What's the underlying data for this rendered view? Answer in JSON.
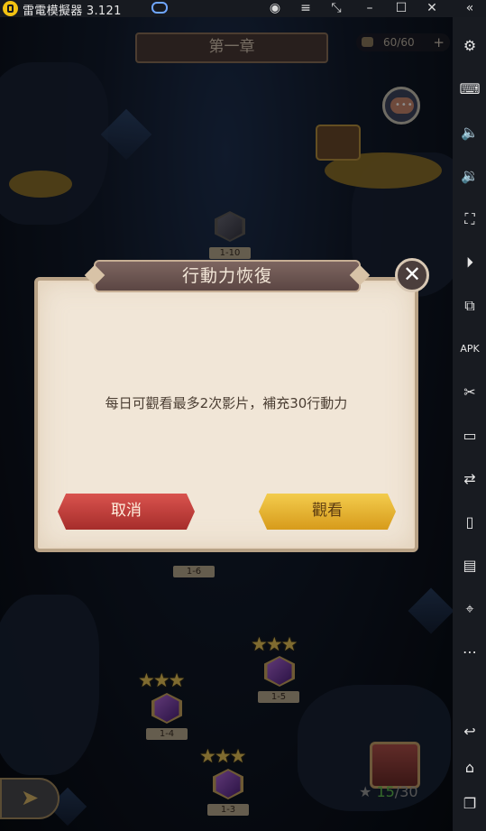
{
  "window": {
    "title": "雷電模擬器 3.121",
    "controls": [
      "account-icon",
      "menu-icon",
      "resize-icon",
      "minimize-icon",
      "maximize-icon",
      "close-icon",
      "collapse-icon"
    ]
  },
  "sidebar": {
    "items": [
      "settings-icon",
      "keyboard-icon",
      "volume-up-icon",
      "volume-down-icon",
      "fullscreen-icon",
      "record-icon",
      "multi-instance-icon",
      "apk-install-icon",
      "screenshot-icon",
      "video-record-icon",
      "sync-icon",
      "rotate-icon",
      "operation-record-icon",
      "location-icon",
      "more-icon",
      "back-icon",
      "home-icon",
      "recent-apps-icon"
    ]
  },
  "game": {
    "chapter_title": "第一章",
    "stamina": "60/60",
    "stamina_plus": "+",
    "levels": {
      "l1_10": "1-10",
      "l1_6": "1-6",
      "l1_5": "1-5",
      "l1_4": "1-4",
      "l1_3": "1-3"
    },
    "stars_glyph": "★★★",
    "star_icon": "★",
    "stars_collected": "15",
    "stars_total": "/30"
  },
  "dialog": {
    "title": "行動力恢復",
    "message": "每日可觀看最多2次影片，補充30行動力",
    "cancel_label": "取消",
    "watch_label": "觀看",
    "close_glyph": "✕"
  },
  "colors": {
    "dialog_bg": "#f1e6d7",
    "cancel_button": "#c9413d",
    "watch_button": "#e6b232",
    "star": "#e7c458",
    "stars_collected": "#5fbf4f"
  }
}
